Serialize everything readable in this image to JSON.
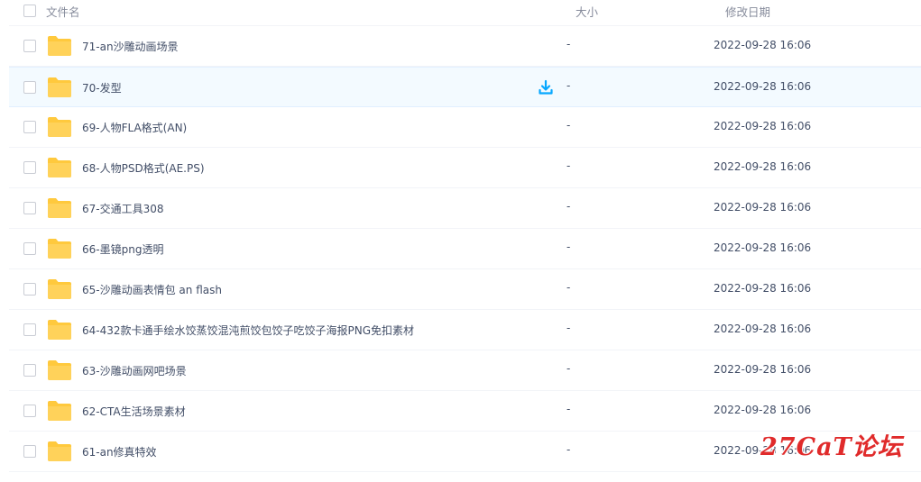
{
  "header": {
    "name_label": "文件名",
    "size_label": "大小",
    "date_label": "修改日期"
  },
  "colors": {
    "folder": "#ffc93d",
    "accent": "#06a7ff",
    "hover_row": "#f3faff",
    "watermark": "#e02b2b"
  },
  "files": [
    {
      "name": "71-an沙雕动画场景",
      "size": "-",
      "date": "2022-09-28 16:06",
      "icon": "folder-icon"
    },
    {
      "name": "70-发型",
      "size": "-",
      "date": "2022-09-28 16:06",
      "icon": "folder-icon",
      "hovered": true
    },
    {
      "name": "69-人物FLA格式(AN)",
      "size": "-",
      "date": "2022-09-28 16:06",
      "icon": "folder-icon"
    },
    {
      "name": "68-人物PSD格式(AE.PS)",
      "size": "-",
      "date": "2022-09-28 16:06",
      "icon": "folder-icon"
    },
    {
      "name": "67-交通工具308",
      "size": "-",
      "date": "2022-09-28 16:06",
      "icon": "folder-icon"
    },
    {
      "name": "66-墨镜png透明",
      "size": "-",
      "date": "2022-09-28 16:06",
      "icon": "folder-icon"
    },
    {
      "name": "65-沙雕动画表情包 an flash",
      "size": "-",
      "date": "2022-09-28 16:06",
      "icon": "folder-icon"
    },
    {
      "name": "64-432款卡通手绘水饺蒸饺混沌煎饺包饺子吃饺子海报PNG免扣素材",
      "size": "-",
      "date": "2022-09-28 16:06",
      "icon": "folder-icon"
    },
    {
      "name": "63-沙雕动画网吧场景",
      "size": "-",
      "date": "2022-09-28 16:06",
      "icon": "folder-icon"
    },
    {
      "name": "62-CTA生活场景素材",
      "size": "-",
      "date": "2022-09-28 16:06",
      "icon": "folder-icon"
    },
    {
      "name": "61-an修真特效",
      "size": "-",
      "date": "2022-09-28 16:06",
      "icon": "folder-icon"
    }
  ],
  "watermark": "27CaT论坛"
}
